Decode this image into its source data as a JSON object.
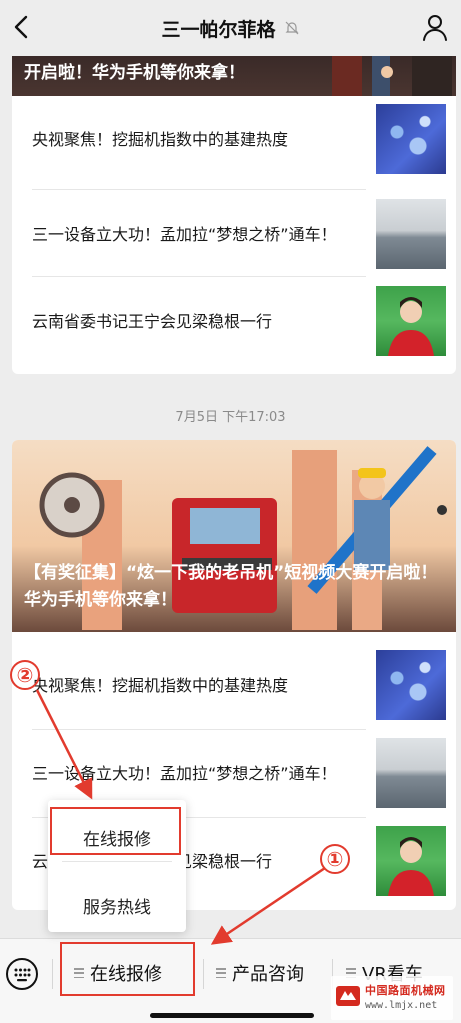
{
  "header": {
    "title": "三一帕尔菲格"
  },
  "card1": {
    "caption": "开启啦！华为手机等你来拿！",
    "items": [
      {
        "text": "央视聚焦！挖掘机指数中的基建热度"
      },
      {
        "text": "三一设备立大功！孟加拉“梦想之桥”通车！"
      },
      {
        "text": "云南省委书记王宁会见梁稳根一行"
      }
    ]
  },
  "timestamp": "7月5日 下午17:03",
  "card2": {
    "caption": "【有奖征集】“炫一下我的老吊机”短视频大赛开启啦！华为手机等你来拿！",
    "items": [
      {
        "text": "央视聚焦！挖掘机指数中的基建热度"
      },
      {
        "text": "三一设备立大功！孟加拉“梦想之桥”通车！"
      },
      {
        "text": "云南省委书记王宁会见梁稳根一行"
      }
    ]
  },
  "popup": {
    "items": [
      "在线报修",
      "服务热线"
    ]
  },
  "bottom_menu": {
    "items": [
      "在线报修",
      "产品咨询",
      "VR看车"
    ]
  },
  "annotations": {
    "one": "①",
    "two": "②"
  },
  "watermark": {
    "name": "中国路面机械网",
    "url": "www.lmjx.net"
  },
  "colors": {
    "annotation_red": "#e23b2e",
    "background": "#ededed"
  }
}
